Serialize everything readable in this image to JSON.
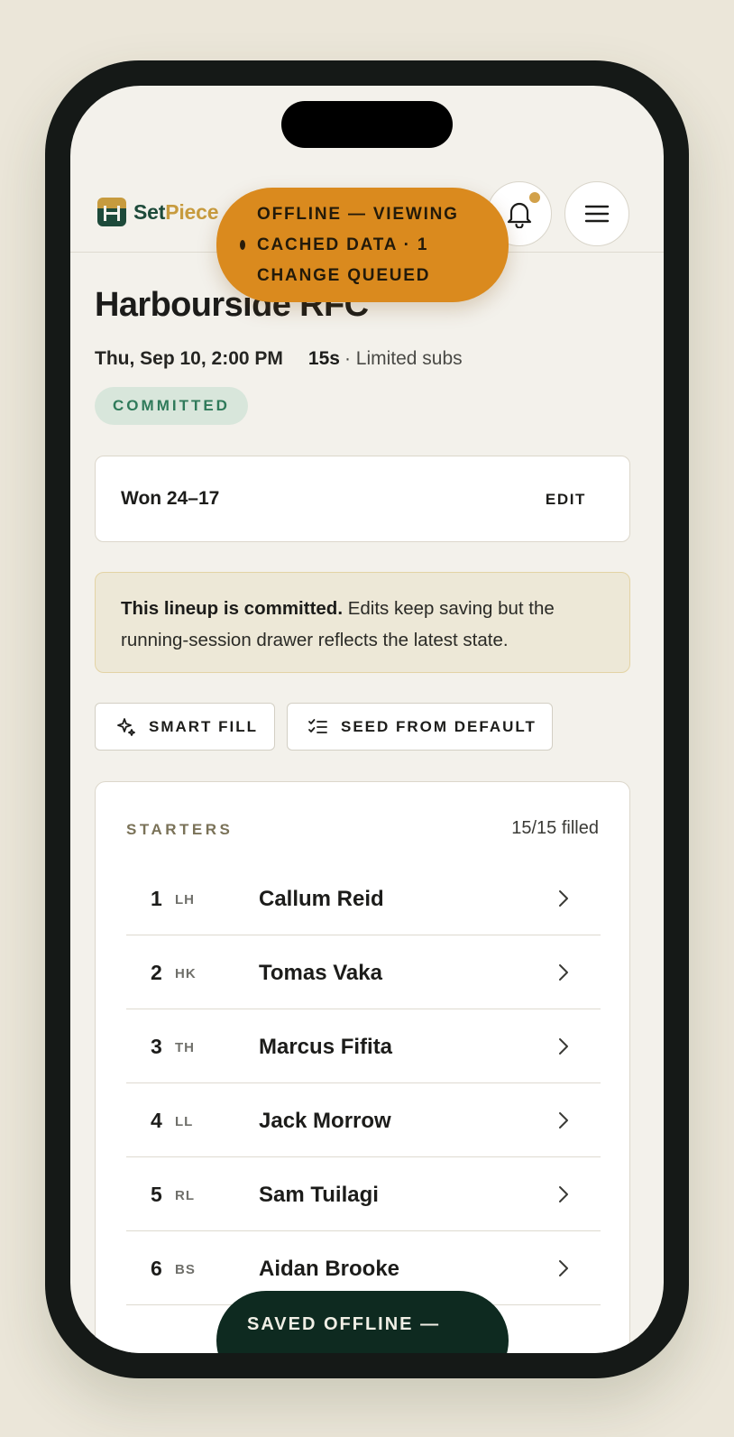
{
  "app": {
    "brand_part1": "Set",
    "brand_part2": "Piece"
  },
  "header": {
    "bell_has_notification": true
  },
  "offline_toast": {
    "text": "OFFLINE — VIEWING CACHED DATA · 1 CHANGE QUEUED",
    "color": "#da8a1e"
  },
  "match": {
    "team": "Harbourside RFC",
    "date": "Thu, Sep 10, 2:00 PM",
    "format": "15s",
    "subs_rule": "· Limited subs",
    "status": "COMMITTED"
  },
  "result": {
    "score": "Won 24–17",
    "edit_label": "EDIT"
  },
  "notice": {
    "bold": "This lineup is committed.",
    "text": " Edits keep saving but the running-session drawer reflects the latest state."
  },
  "actions": {
    "smart_fill": "SMART FILL",
    "seed_default": "SEED FROM DEFAULT"
  },
  "starters": {
    "title": "STARTERS",
    "count": "15/15 filled",
    "rows": [
      {
        "num": "1",
        "pos": "LH",
        "name": "Callum Reid"
      },
      {
        "num": "2",
        "pos": "HK",
        "name": "Tomas Vaka"
      },
      {
        "num": "3",
        "pos": "TH",
        "name": "Marcus Fifita"
      },
      {
        "num": "4",
        "pos": "LL",
        "name": "Jack Morrow"
      },
      {
        "num": "5",
        "pos": "RL",
        "name": "Sam Tuilagi"
      },
      {
        "num": "6",
        "pos": "BS",
        "name": "Aidan Brooke"
      }
    ]
  },
  "saved_toast": {
    "text": "SAVED OFFLINE —"
  },
  "icons": [
    "bell-icon",
    "hamburger-menu-icon",
    "sparkle-icon",
    "checklist-icon",
    "chevron-right-icon"
  ]
}
